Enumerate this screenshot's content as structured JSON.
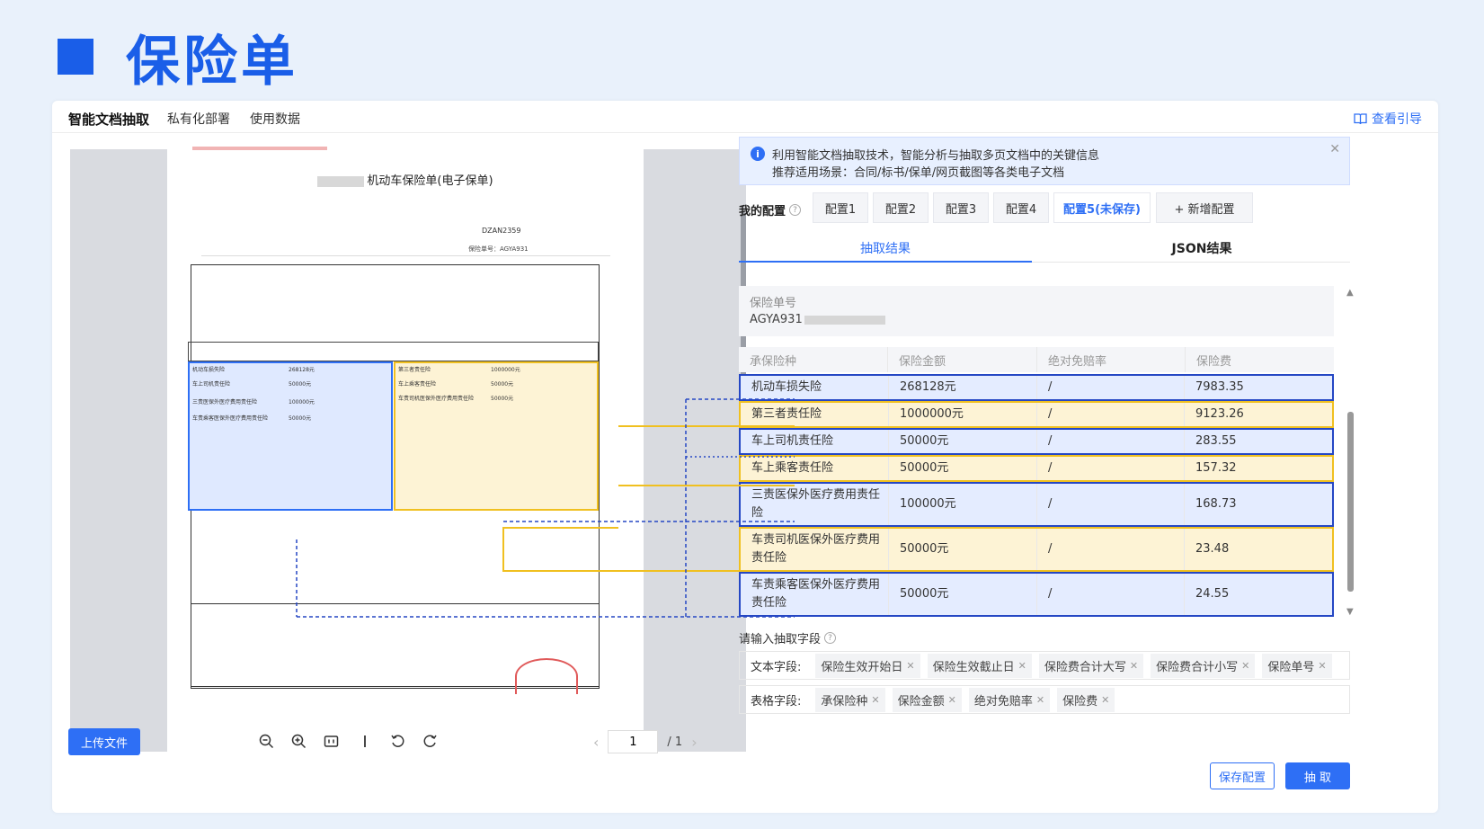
{
  "slide": {
    "title": "保险单"
  },
  "topnav": {
    "items": [
      "智能文档抽取",
      "私有化部署",
      "使用数据"
    ],
    "guide": "查看引导"
  },
  "document": {
    "title": "机动车保险单(电子保单)",
    "code": "DZAN2359",
    "policy_no": "保险单号：AGYA931",
    "table_left_rows": [
      "机动车损失险",
      "车上司机责任险",
      "三责医保外医疗费用责任险",
      "车责乘客医保外医疗费用责任险"
    ],
    "table_left_amounts": [
      "268128元",
      "50000元",
      "100000元",
      "50000元"
    ],
    "table_right_rows": [
      "第三者责任险",
      "车上乘客责任险",
      "车责司机医保外医疗费用责任险"
    ],
    "table_right_amounts": [
      "1000000元",
      "50000元",
      "50000元"
    ]
  },
  "viewer": {
    "upload": "上传文件",
    "page_current": "1",
    "page_total": "/ 1"
  },
  "info": {
    "line1": "利用智能文档抽取技术，智能分析与抽取多页文档中的关键信息",
    "line2": "推荐适用场景：合同/标书/保单/网页截图等各类电子文档"
  },
  "config": {
    "label": "我的配置",
    "tabs": [
      "配置1",
      "配置2",
      "配置3",
      "配置4",
      "配置5(未保存)",
      "+ 新增配置"
    ]
  },
  "subtabs": [
    "抽取结果",
    "JSON结果"
  ],
  "policy": {
    "label": "保险单号",
    "value": "AGYA931"
  },
  "result_table": {
    "headers": [
      "承保险种",
      "保险金额",
      "绝对免赔率",
      "保险费"
    ],
    "rows": [
      {
        "type": "机动车损失险",
        "amount": "268128元",
        "deductible": "/",
        "premium": "7983.35",
        "color": "blue"
      },
      {
        "type": "第三者责任险",
        "amount": "1000000元",
        "deductible": "/",
        "premium": "9123.26",
        "color": "yellow"
      },
      {
        "type": "车上司机责任险",
        "amount": "50000元",
        "deductible": "/",
        "premium": "283.55",
        "color": "blue"
      },
      {
        "type": "车上乘客责任险",
        "amount": "50000元",
        "deductible": "/",
        "premium": "157.32",
        "color": "yellow"
      },
      {
        "type": "三责医保外医疗费用责任险",
        "amount": "100000元",
        "deductible": "/",
        "premium": "168.73",
        "color": "blue"
      },
      {
        "type": "车责司机医保外医疗费用责任险",
        "amount": "50000元",
        "deductible": "/",
        "premium": "23.48",
        "color": "yellow"
      },
      {
        "type": "车责乘客医保外医疗费用责任险",
        "amount": "50000元",
        "deductible": "/",
        "premium": "24.55",
        "color": "blue"
      }
    ]
  },
  "fields": {
    "label": "请输入抽取字段",
    "text_label": "文本字段:",
    "text_tags": [
      "保险生效开始日",
      "保险生效截止日",
      "保险费合计大写",
      "保险费合计小写",
      "保险单号"
    ],
    "table_label": "表格字段:",
    "table_tags": [
      "承保险种",
      "保险金额",
      "绝对免赔率",
      "保险费"
    ]
  },
  "buttons": {
    "save": "保存配置",
    "extract": "抽 取"
  },
  "colors": {
    "accent": "#2e6ff5",
    "blue_box": "#2547c4",
    "yellow_box": "#f0c020"
  }
}
